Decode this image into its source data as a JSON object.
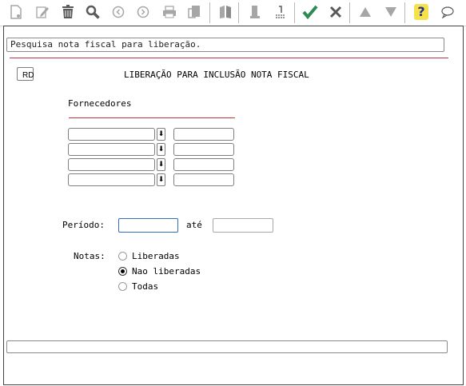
{
  "toolbar": {
    "items": [
      {
        "icon": "new-document-icon"
      },
      {
        "icon": "edit-icon"
      },
      {
        "icon": "trash-icon"
      },
      {
        "icon": "search-icon"
      },
      {
        "icon": "previous-icon"
      },
      {
        "icon": "next-icon"
      },
      {
        "icon": "print-icon"
      },
      {
        "icon": "export-icon"
      },
      {
        "icon": "book-icon"
      },
      {
        "icon": "bookmark-icon"
      },
      {
        "icon": "list-icon"
      },
      {
        "icon": "confirm-check-icon"
      },
      {
        "icon": "cancel-icon"
      },
      {
        "icon": "first-icon"
      },
      {
        "icon": "last-icon"
      },
      {
        "icon": "help-icon"
      },
      {
        "icon": "comment-icon"
      }
    ]
  },
  "header": {
    "value": "Pesquisa nota fiscal para liberação."
  },
  "form": {
    "rd_label": "RD",
    "title": "LIBERAÇÃO PARA INCLUSÃO NOTA FISCAL",
    "fornecedores_label": "Fornecedores",
    "fornecedores": [
      {
        "code": "",
        "name": ""
      },
      {
        "code": "",
        "name": ""
      },
      {
        "code": "",
        "name": ""
      },
      {
        "code": "",
        "name": ""
      }
    ],
    "periodo_label": "Período:",
    "periodo_from": "",
    "ate_label": "até",
    "periodo_to": "",
    "notas_label": "Notas:",
    "notas_options": [
      {
        "label": "Liberadas",
        "checked": false
      },
      {
        "label": "Nao liberadas",
        "checked": true
      },
      {
        "label": "Todas",
        "checked": false
      }
    ]
  },
  "status": {
    "text": ""
  },
  "colors": {
    "accent_line": "#c8333d",
    "focus_border": "#2f6fbe"
  }
}
